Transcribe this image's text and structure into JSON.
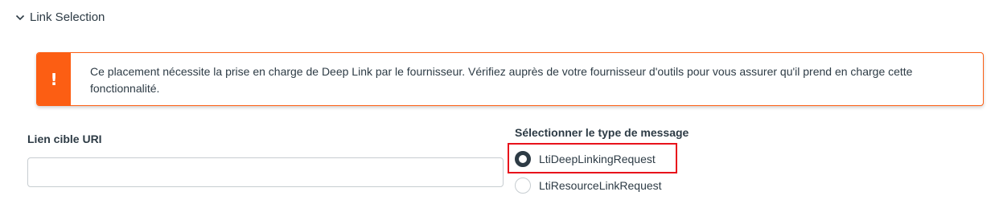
{
  "section": {
    "title": "Link Selection",
    "expanded": true
  },
  "alert": {
    "icon": "!",
    "message": "Ce placement nécessite la prise en charge de Deep Link par le fournisseur. Vérifiez auprès de votre fournisseur d'outils pour vous assurer qu'il prend en charge cette fonctionnalité.",
    "color": "#fc5e13"
  },
  "target_uri": {
    "label": "Lien cible URI",
    "value": "",
    "placeholder": ""
  },
  "message_type": {
    "label": "Sélectionner le type de message",
    "options": [
      {
        "label": "LtiDeepLinkingRequest",
        "selected": true
      },
      {
        "label": "LtiResourceLinkRequest",
        "selected": false
      }
    ]
  },
  "colors": {
    "text": "#2d3b45",
    "highlight": "#e8121b",
    "warning": "#fc5e13"
  }
}
